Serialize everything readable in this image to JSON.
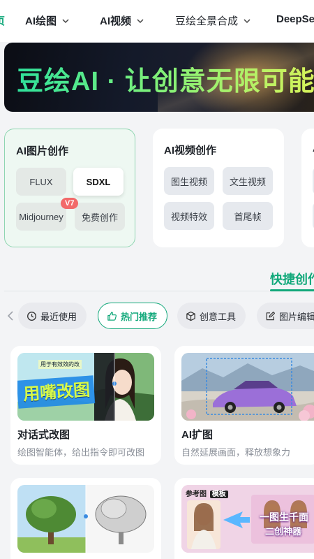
{
  "nav": {
    "items": [
      {
        "label": "页",
        "active": true
      },
      {
        "label": "AI绘图"
      },
      {
        "label": "AI视频"
      },
      {
        "label": "豆绘全景合成"
      },
      {
        "label": "DeepSe"
      }
    ]
  },
  "banner": {
    "text": "豆绘AI · 让创意无限可能"
  },
  "image_card": {
    "title": "AI图片创作",
    "chips": [
      "FLUX",
      "SDXL",
      "Midjourney",
      "免费创作"
    ],
    "selected": "SDXL",
    "badge": "V7"
  },
  "video_card": {
    "title": "AI视频创作",
    "chips": [
      "图生视频",
      "文生视频",
      "视频特效",
      "首尾帧"
    ]
  },
  "third_card": {
    "title": "A"
  },
  "quick": {
    "label": "快捷创作"
  },
  "filters": [
    {
      "label": "最近使用",
      "icon": "clock-icon"
    },
    {
      "label": "热门推荐",
      "icon": "thumbs-up-icon",
      "active": true
    },
    {
      "label": "创意工具",
      "icon": "cube-icon"
    },
    {
      "label": "图片编辑",
      "icon": "edit-icon"
    }
  ],
  "features": [
    {
      "title": "对话式改图",
      "desc": "绘图智能体，给出指令即可改图",
      "thumb_text": "用嘴改图",
      "thumb_sub": "用于有效效的改",
      "colors": {
        "accent": "#1e88e5"
      }
    },
    {
      "title": "AI扩图",
      "desc": "自然延展画面，释放想象力"
    },
    {
      "title": "",
      "desc": ""
    },
    {
      "title": "",
      "desc": "",
      "thumb_tag": "参考图",
      "thumb_tag2": "模板",
      "thumb_text": "一图生千面",
      "thumb_sub": "二创神器"
    }
  ],
  "colors": {
    "accent": "#11a87a",
    "badge": "#f26a6a"
  }
}
